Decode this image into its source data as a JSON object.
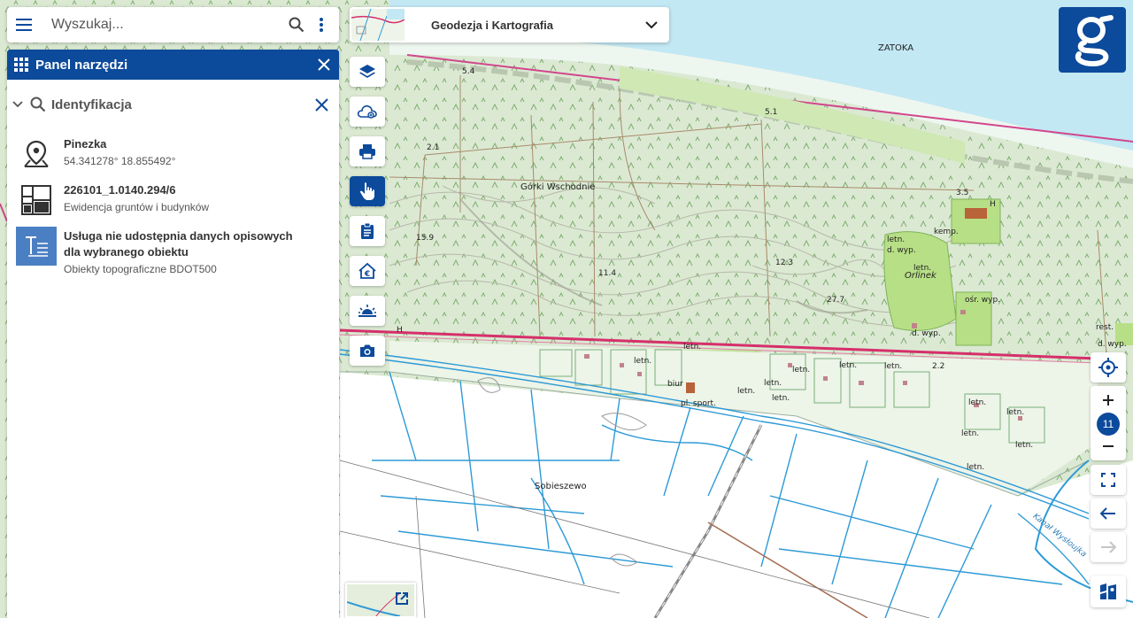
{
  "search": {
    "placeholder": "Wyszukaj..."
  },
  "panel": {
    "title": "Panel narzędzi"
  },
  "identification": {
    "title": "Identyfikacja",
    "results": [
      {
        "icon": "location-pin-icon",
        "title": "Pinezka",
        "subtitle": "54.341278° 18.855492°"
      },
      {
        "icon": "parcel-icon",
        "title": "226101_1.0140.294/6",
        "subtitle": "Ewidencja gruntów i budynków"
      },
      {
        "icon": "text-description-icon",
        "title": "Usługa nie udostępnia danych opisowych dla wybranego obiektu",
        "subtitle": "Obiekty topograficzne BDOT500"
      }
    ]
  },
  "layer_selector": {
    "label": "Geodezja i Kartografia"
  },
  "toolbar": [
    {
      "name": "layers-button",
      "icon": "layers-icon",
      "active": false
    },
    {
      "name": "cloud-data-button",
      "icon": "cloud-icon",
      "active": false
    },
    {
      "name": "print-button",
      "icon": "printer-icon",
      "active": false
    },
    {
      "name": "identify-button",
      "icon": "hand-pointer-icon",
      "active": true
    },
    {
      "name": "clipboard-button",
      "icon": "clipboard-icon",
      "active": false
    },
    {
      "name": "real-estate-price-button",
      "icon": "house-euro-icon",
      "active": false
    },
    {
      "name": "sunrise-button",
      "icon": "sunrise-icon",
      "active": false
    },
    {
      "name": "screenshot-button",
      "icon": "camera-icon",
      "active": false
    }
  ],
  "zoom": {
    "level": "11"
  },
  "map_labels": {
    "zatoka": "ZATOKA",
    "gorki": "Górki Wschodnie",
    "sobieszewo": "Sobieszewo",
    "orlinek": "Orlinek",
    "kemp": "kemp.",
    "letn": "letn.",
    "d_wyp": "d. wyp.",
    "osr_wyp": "ośr. wyp.",
    "rest": "rest.",
    "biur": "biur",
    "pl_sport": "pl. sport.",
    "kanal": "Kanał Wysłoujka",
    "h": "H",
    "e54": "5.4",
    "e51": "5.1",
    "e21": "2.1",
    "e35": "3.5",
    "e159": "15.9",
    "e114": "11.4",
    "e123": "12.3",
    "e277": "27.7",
    "e22": "2.2"
  },
  "colors": {
    "brand": "#0c4a9b",
    "sea": "#c2e8f4",
    "forest": "#dbe9d3",
    "meadow": "#b7df86",
    "water_lines": "#2d9ad6",
    "road": "#d62f6b"
  }
}
